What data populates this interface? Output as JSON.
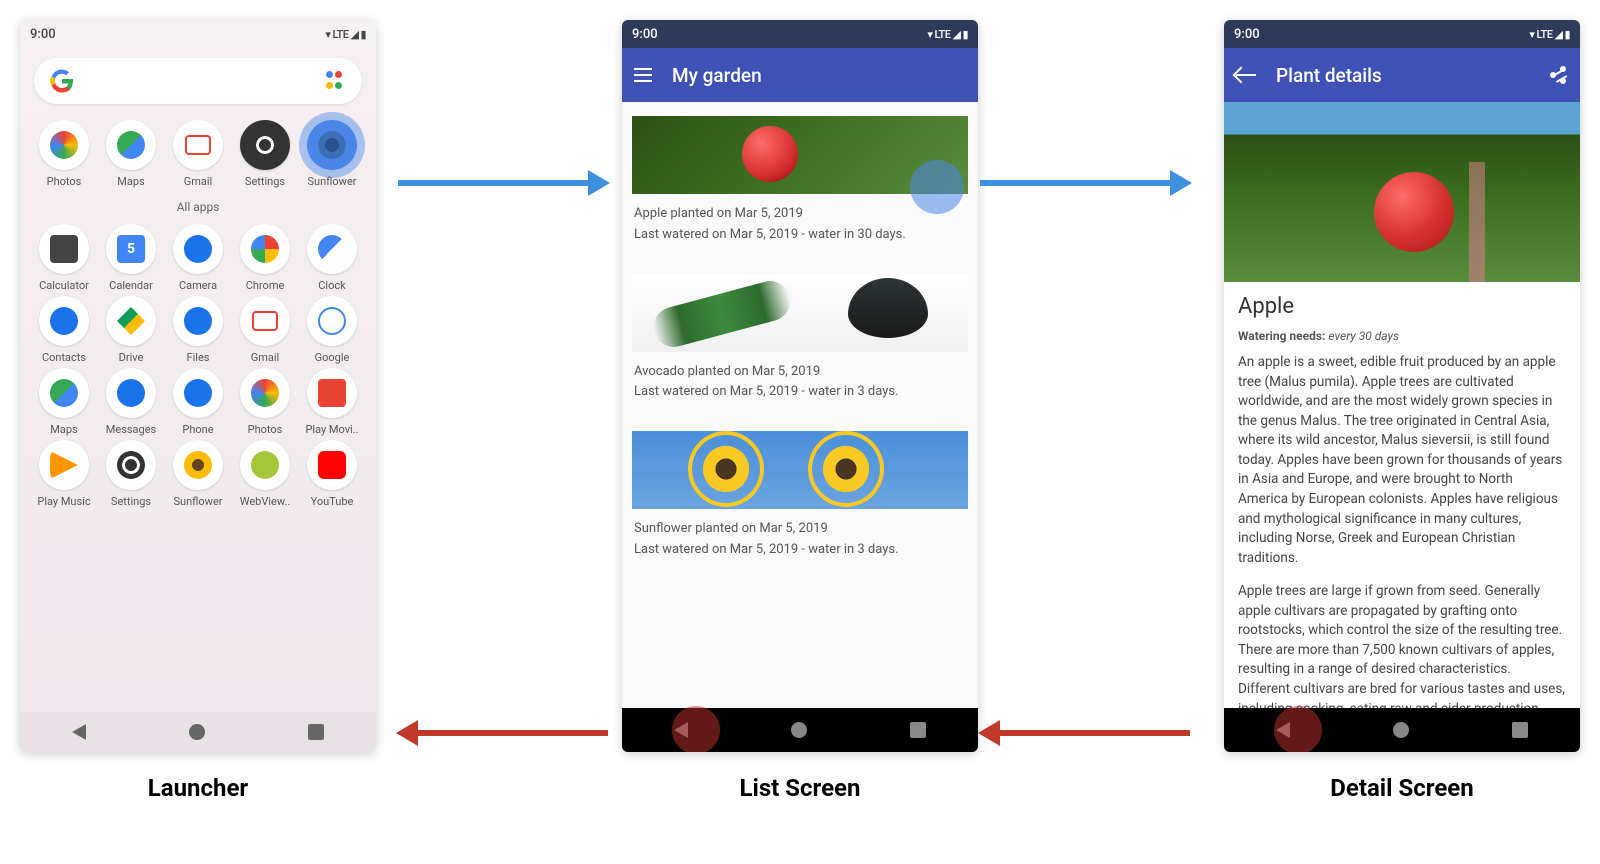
{
  "status": {
    "time": "9:00",
    "net": "LTE"
  },
  "captions": {
    "launcher": "Launcher",
    "list": "List Screen",
    "detail": "Detail Screen"
  },
  "launcher": {
    "all_apps_label": "All apps",
    "favorites": [
      {
        "label": "Photos"
      },
      {
        "label": "Maps"
      },
      {
        "label": "Gmail"
      },
      {
        "label": "Settings"
      },
      {
        "label": "Sunflower"
      }
    ],
    "apps": [
      {
        "label": "Calculator"
      },
      {
        "label": "Calendar"
      },
      {
        "label": "Camera"
      },
      {
        "label": "Chrome"
      },
      {
        "label": "Clock"
      },
      {
        "label": "Contacts"
      },
      {
        "label": "Drive"
      },
      {
        "label": "Files"
      },
      {
        "label": "Gmail"
      },
      {
        "label": "Google"
      },
      {
        "label": "Maps"
      },
      {
        "label": "Messages"
      },
      {
        "label": "Phone"
      },
      {
        "label": "Photos"
      },
      {
        "label": "Play Movi.."
      },
      {
        "label": "Play Music"
      },
      {
        "label": "Settings"
      },
      {
        "label": "Sunflower"
      },
      {
        "label": "WebView.."
      },
      {
        "label": "YouTube"
      }
    ]
  },
  "list": {
    "title": "My garden",
    "items": [
      {
        "line1": "Apple planted on Mar 5, 2019",
        "line2": "Last watered on Mar 5, 2019 - water in 30 days."
      },
      {
        "line1": "Avocado planted on Mar 5, 2019",
        "line2": "Last watered on Mar 5, 2019 - water in 3 days."
      },
      {
        "line1": "Sunflower planted on Mar 5, 2019",
        "line2": "Last watered on Mar 5, 2019 - water in 3 days."
      }
    ]
  },
  "detail": {
    "bar_title": "Plant details",
    "title": "Apple",
    "sub_label": "Watering needs:",
    "sub_value": "every 30 days",
    "para1": "An apple is a sweet, edible fruit produced by an apple tree (Malus pumila). Apple trees are cultivated worldwide, and are the most widely grown species in the genus Malus. The tree originated in Central Asia, where its wild ancestor, Malus sieversii, is still found today. Apples have been grown for thousands of years in Asia and Europe, and were brought to North America by European colonists. Apples have religious and mythological significance in many cultures, including Norse, Greek and European Christian traditions.",
    "para2": "Apple trees are large if grown from seed. Generally apple cultivars are propagated by grafting onto rootstocks, which control the size of the resulting tree. There are more than 7,500 known cultivars of apples, resulting in a range of desired characteristics. Different cultivars are bred for various tastes and uses, including cooking, eating raw and cider production. Trees and fruit"
  }
}
